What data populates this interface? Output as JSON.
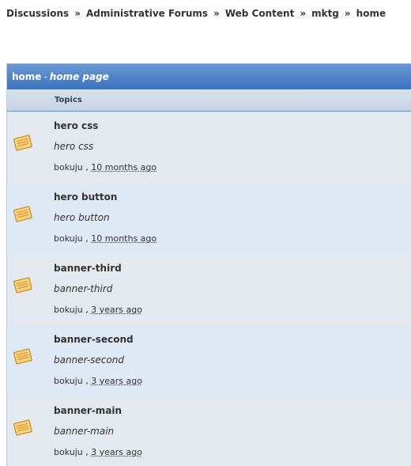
{
  "breadcrumb": {
    "items": [
      "Discussions",
      "Administrative Forums",
      "Web Content",
      "mktg",
      "home"
    ],
    "separator": "»"
  },
  "forum": {
    "name": "home",
    "separator": "-",
    "description": "home page",
    "column_header": "Topics"
  },
  "topics": [
    {
      "title": "hero css",
      "description": "hero css",
      "author": "bokuju",
      "meta_sep": " , ",
      "time": "10 months ago"
    },
    {
      "title": "hero button",
      "description": "hero button",
      "author": "bokuju",
      "meta_sep": " , ",
      "time": "10 months ago"
    },
    {
      "title": "banner-third",
      "description": "banner-third",
      "author": "bokuju",
      "meta_sep": " , ",
      "time": "3 years ago"
    },
    {
      "title": "banner-second",
      "description": "banner-second",
      "author": "bokuju",
      "meta_sep": " , ",
      "time": "3 years ago"
    },
    {
      "title": "banner-main",
      "description": "banner-main",
      "author": "bokuju",
      "meta_sep": " , ",
      "time": "3 years ago"
    }
  ],
  "colors": {
    "header_blue": "#3b73c0",
    "row_odd": "#e4e9f0",
    "row_even": "#dfe8f5"
  },
  "icons": {
    "topic": "note-icon"
  }
}
